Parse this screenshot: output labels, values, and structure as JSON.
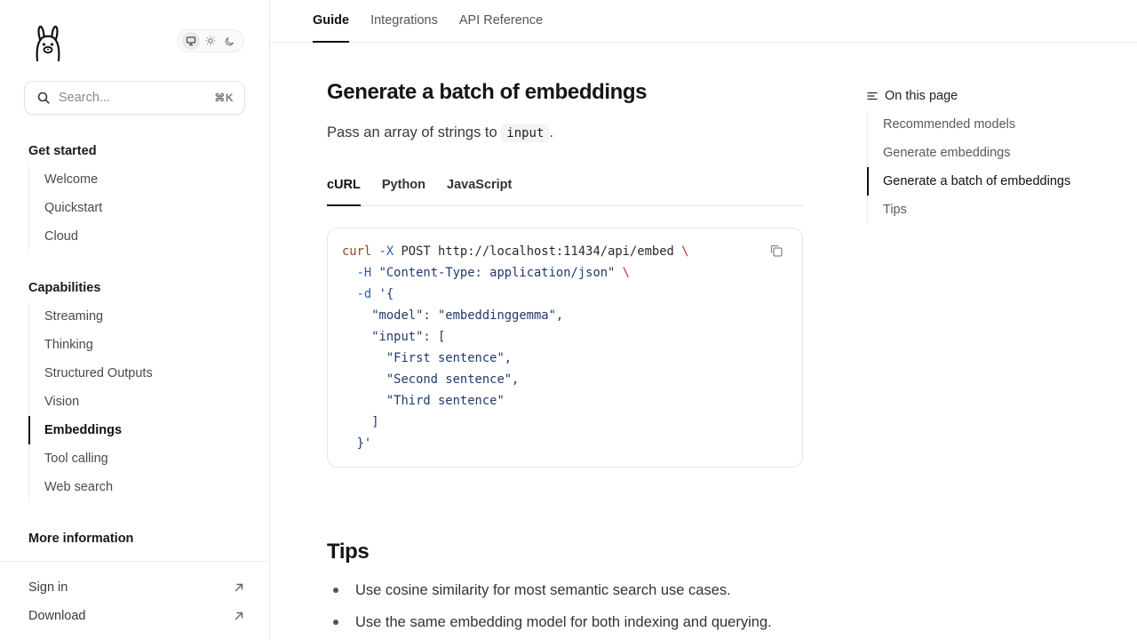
{
  "sidebar": {
    "logo": "llama-logo-icon",
    "theme_toggle": {
      "options": [
        "system-icon",
        "sun-icon",
        "moon-icon"
      ],
      "active": "system-icon"
    },
    "search": {
      "placeholder": "Search...",
      "shortcut": "⌘K"
    },
    "groups": [
      {
        "title": "Get started",
        "items": [
          {
            "label": "Welcome"
          },
          {
            "label": "Quickstart"
          },
          {
            "label": "Cloud"
          }
        ]
      },
      {
        "title": "Capabilities",
        "items": [
          {
            "label": "Streaming"
          },
          {
            "label": "Thinking"
          },
          {
            "label": "Structured Outputs"
          },
          {
            "label": "Vision"
          },
          {
            "label": "Embeddings",
            "active": true
          },
          {
            "label": "Tool calling"
          },
          {
            "label": "Web search"
          }
        ]
      },
      {
        "title": "More information",
        "items": []
      }
    ],
    "footer": [
      {
        "label": "Sign in",
        "icon": "external-arrow-icon"
      },
      {
        "label": "Download",
        "icon": "external-arrow-icon"
      }
    ]
  },
  "topnav": {
    "tabs": [
      {
        "label": "Guide",
        "active": true
      },
      {
        "label": "Integrations"
      },
      {
        "label": "API Reference"
      }
    ]
  },
  "main": {
    "title": "Generate a batch of embeddings",
    "lede_prefix": "Pass an array of strings to",
    "lede_code": "input",
    "lede_suffix": ".",
    "code_tabs": [
      {
        "label": "cURL",
        "active": true
      },
      {
        "label": "Python"
      },
      {
        "label": "JavaScript"
      }
    ],
    "code": {
      "l1_cmd": "curl",
      "l1_flag": "-X",
      "l1_rest": "POST http://localhost:11434/api/embed",
      "l1_esc": "\\",
      "l2_flag": "-H",
      "l2_str": "\"Content-Type: application/json\"",
      "l2_esc": "\\",
      "l3_flag": "-d",
      "l3_str": "'{",
      "l4": "\"model\": \"embeddinggemma\",",
      "l5": "\"input\": [",
      "l6": "\"First sentence\",",
      "l7": "\"Second sentence\",",
      "l8": "\"Third sentence\"",
      "l9": "]",
      "l10": "}'"
    },
    "tips_title": "Tips",
    "tips": [
      "Use cosine similarity for most semantic search use cases.",
      "Use the same embedding model for both indexing and querying."
    ]
  },
  "toc": {
    "heading": "On this page",
    "items": [
      {
        "label": "Recommended models"
      },
      {
        "label": "Generate embeddings"
      },
      {
        "label": "Generate a batch of embeddings",
        "active": true
      },
      {
        "label": "Tips"
      }
    ]
  }
}
